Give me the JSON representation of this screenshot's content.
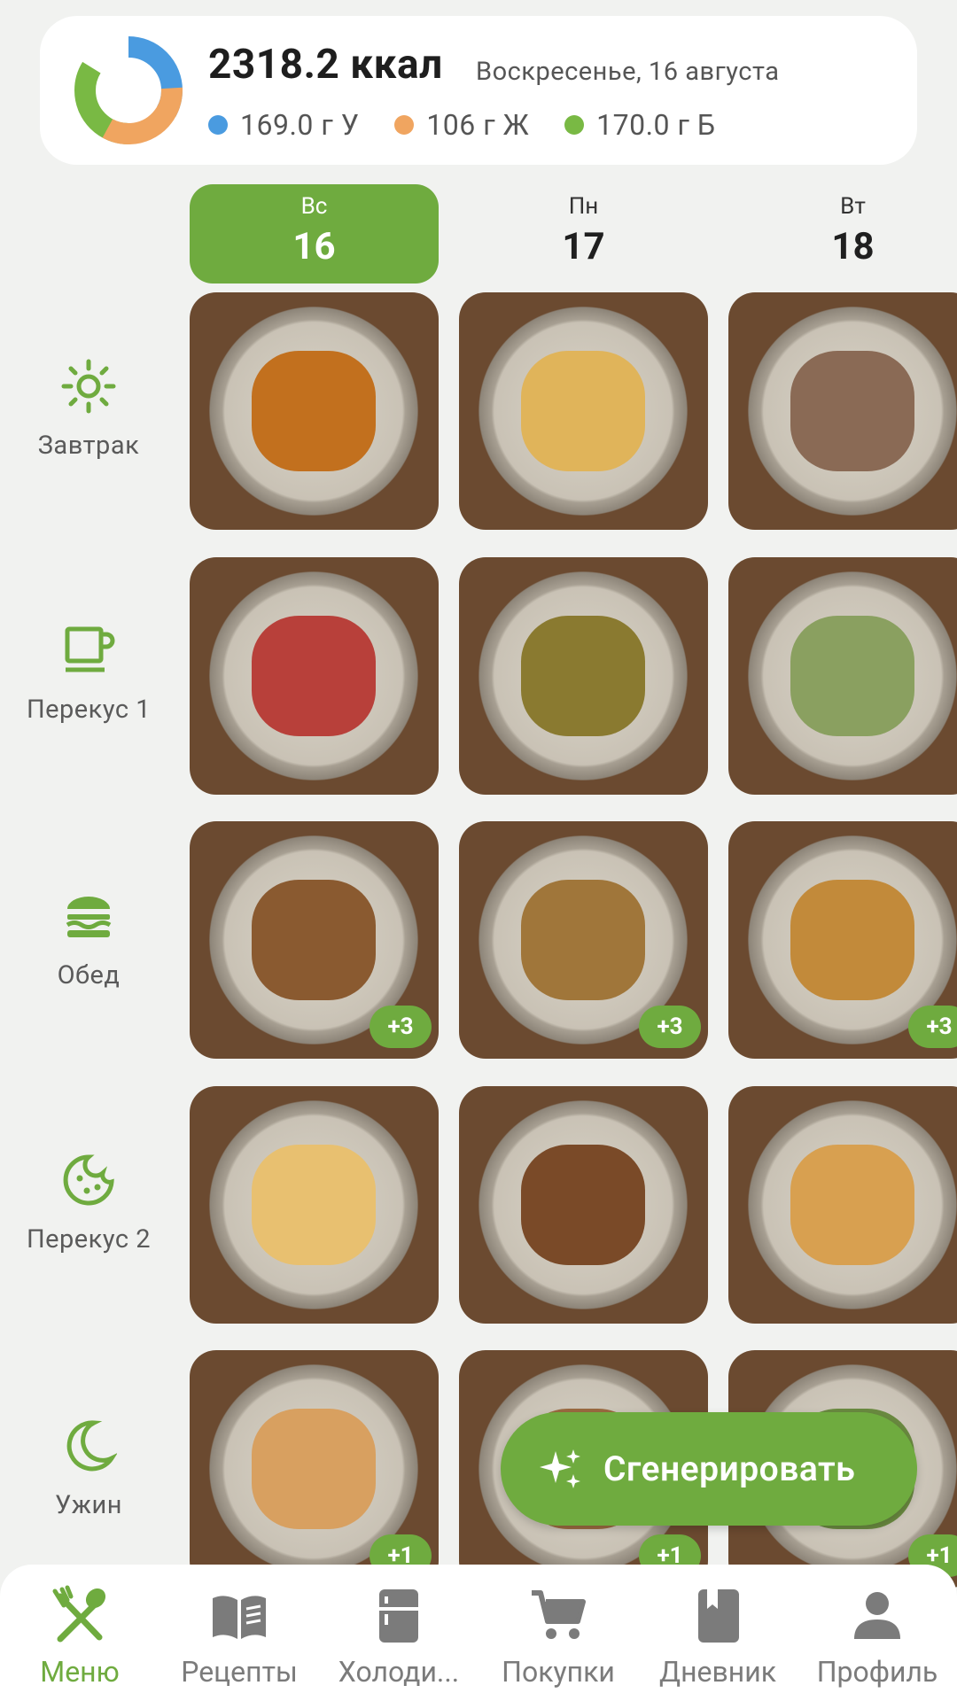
{
  "summary": {
    "kcal": "2318.2 ккал",
    "date": "Воскресенье, 16 августа",
    "macros": [
      {
        "label": "169.0 г У",
        "color": "#4a9be0"
      },
      {
        "label": "106 г Ж",
        "color": "#f0a560"
      },
      {
        "label": "170.0 г Б",
        "color": "#79b944"
      }
    ]
  },
  "days": [
    {
      "dow": "Вс",
      "num": "16",
      "active": true
    },
    {
      "dow": "Пн",
      "num": "17",
      "active": false
    },
    {
      "dow": "Вт",
      "num": "18",
      "active": false
    }
  ],
  "meals": [
    {
      "label": "Завтрак",
      "icon": "sun-icon"
    },
    {
      "label": "Перекус 1",
      "icon": "cup-icon"
    },
    {
      "label": "Обед",
      "icon": "burger-icon"
    },
    {
      "label": "Перекус 2",
      "icon": "cookie-icon"
    },
    {
      "label": "Ужин",
      "icon": "moon-icon"
    }
  ],
  "grid": [
    [
      {
        "badge": ""
      },
      {
        "badge": ""
      },
      {
        "badge": ""
      }
    ],
    [
      {
        "badge": ""
      },
      {
        "badge": ""
      },
      {
        "badge": ""
      }
    ],
    [
      {
        "badge": "+3"
      },
      {
        "badge": "+3"
      },
      {
        "badge": "+3"
      }
    ],
    [
      {
        "badge": ""
      },
      {
        "badge": ""
      },
      {
        "badge": ""
      }
    ],
    [
      {
        "badge": "+1"
      },
      {
        "badge": "+1"
      },
      {
        "badge": "+1"
      }
    ]
  ],
  "generate_label": "Сгенерировать",
  "nav": [
    {
      "label": "Меню",
      "icon": "fork-spoon-icon",
      "active": true
    },
    {
      "label": "Рецепты",
      "icon": "book-icon",
      "active": false
    },
    {
      "label": "Холоди...",
      "icon": "fridge-icon",
      "active": false
    },
    {
      "label": "Покупки",
      "icon": "cart-icon",
      "active": false
    },
    {
      "label": "Дневник",
      "icon": "diary-icon",
      "active": false
    },
    {
      "label": "Профиль",
      "icon": "person-icon",
      "active": false
    }
  ],
  "colors": {
    "accent": "#6fab3f"
  }
}
